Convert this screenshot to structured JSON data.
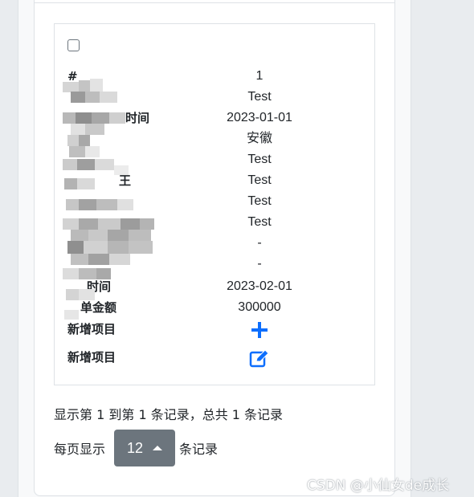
{
  "table": {
    "rows": [
      {
        "label": "#",
        "value": "1"
      },
      {
        "label": "",
        "value": "Test"
      },
      {
        "label": "时间",
        "value": "2023-01-01"
      },
      {
        "label": "",
        "value": "安徽"
      },
      {
        "label": "",
        "value": "Test"
      },
      {
        "label": "王",
        "value": "Test"
      },
      {
        "label": "",
        "value": "Test"
      },
      {
        "label": "",
        "value": "Test"
      },
      {
        "label": "",
        "value": "-"
      },
      {
        "label": "",
        "value": "-"
      },
      {
        "label": "时间",
        "value": "2023-02-01"
      },
      {
        "label": "单金额",
        "value": "300000"
      }
    ],
    "add_row_label": "新增项目",
    "edit_row_label": "新增项目"
  },
  "pagination": {
    "summary": "显示第 1 到第 1 条记录，总共 1 条记录",
    "per_page_prefix": "每页显示",
    "per_page_value": "12",
    "per_page_suffix": "条记录"
  },
  "watermark": "CSDN @小仙女de成长",
  "colors": {
    "icon_blue": "#0d6efd",
    "button_gray": "#6c757d"
  }
}
